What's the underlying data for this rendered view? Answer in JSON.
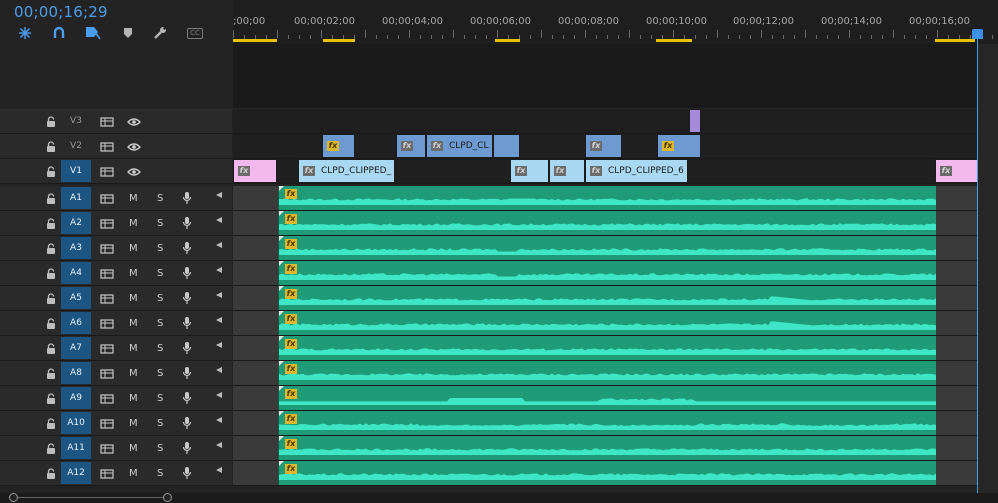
{
  "timecode": "00;00;16;29",
  "toolbar": [
    {
      "name": "snap-icon"
    },
    {
      "name": "linked-selection-icon"
    },
    {
      "name": "add-marker-icon"
    },
    {
      "name": "marker-icon"
    },
    {
      "name": "wrench-icon"
    },
    {
      "name": "captions-icon",
      "label": "CC"
    }
  ],
  "ruler": {
    "labels": [
      ";00;00",
      "00;00;02;00",
      "00;00;04;00",
      "00;00;06;00",
      "00;00;08;00",
      "00;00;10;00",
      "00;00;12;00",
      "00;00;14;00",
      "00;00;16;00"
    ]
  },
  "video_tracks": [
    {
      "label": "V3",
      "clips": [
        {
          "kind": "adj",
          "text": ""
        }
      ]
    },
    {
      "label": "V2",
      "clips": [
        {
          "kind": "v",
          "fx": "gold",
          "text": ""
        },
        {
          "kind": "v",
          "fx": "grey",
          "text": ""
        },
        {
          "kind": "v",
          "fx": "grey",
          "text": "CLPD_CL"
        },
        {
          "kind": "v",
          "fx": "",
          "text": ""
        },
        {
          "kind": "v",
          "fx": "grey",
          "text": ""
        },
        {
          "kind": "v",
          "fx": "gold",
          "text": ""
        }
      ]
    },
    {
      "label": "V1",
      "clips": [
        {
          "kind": "pink",
          "fx": "grey",
          "text": ""
        },
        {
          "kind": "v1",
          "fx": "grey",
          "text": "CLPD_CLIPPED_"
        },
        {
          "kind": "v1",
          "fx": "grey",
          "text": ""
        },
        {
          "kind": "v1",
          "fx": "grey",
          "text": ""
        },
        {
          "kind": "v1",
          "fx": "grey",
          "text": "CLPD_CLIPPED_6"
        },
        {
          "kind": "pink",
          "fx": "grey",
          "text": ""
        }
      ]
    }
  ],
  "audio_tracks": [
    {
      "label": "A1",
      "mute": "M",
      "solo": "S",
      "fx": "fx"
    },
    {
      "label": "A2",
      "mute": "M",
      "solo": "S",
      "fx": "fx"
    },
    {
      "label": "A3",
      "mute": "M",
      "solo": "S",
      "fx": "fx"
    },
    {
      "label": "A4",
      "mute": "M",
      "solo": "S",
      "fx": "fx"
    },
    {
      "label": "A5",
      "mute": "M",
      "solo": "S",
      "fx": "fx"
    },
    {
      "label": "A6",
      "mute": "M",
      "solo": "S",
      "fx": "fx"
    },
    {
      "label": "A7",
      "mute": "M",
      "solo": "S",
      "fx": "fx"
    },
    {
      "label": "A8",
      "mute": "M",
      "solo": "S",
      "fx": "fx"
    },
    {
      "label": "A9",
      "mute": "M",
      "solo": "S",
      "fx": "fx"
    },
    {
      "label": "A10",
      "mute": "M",
      "solo": "S",
      "fx": "fx"
    },
    {
      "label": "A11",
      "mute": "M",
      "solo": "S",
      "fx": "fx"
    },
    {
      "label": "A12",
      "mute": "M",
      "solo": "S",
      "fx": "fx"
    }
  ],
  "colors": {
    "timecode": "#4a9ded",
    "playhead": "#4a9ded",
    "video_clip": "#6d9bd1",
    "v1_clip": "#a9d8f2",
    "transition_clip": "#f3b8ec",
    "adjustment_clip": "#a48ad8",
    "audio_clip": "#1f9c77",
    "waveform": "#3fe6c5",
    "work_area": "#e6c200"
  }
}
